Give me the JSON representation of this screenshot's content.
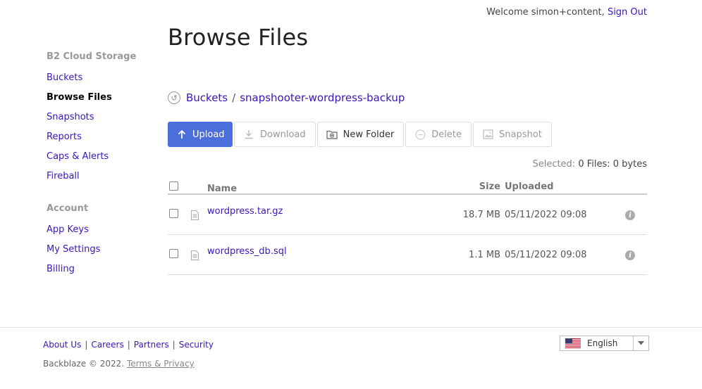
{
  "header": {
    "welcome_text": "Welcome simon+content,",
    "sign_out": "Sign Out"
  },
  "sidebar": {
    "section1": "B2 Cloud Storage",
    "items1": [
      {
        "label": "Buckets",
        "active": false
      },
      {
        "label": "Browse Files",
        "active": true
      },
      {
        "label": "Snapshots",
        "active": false
      },
      {
        "label": "Reports",
        "active": false
      },
      {
        "label": "Caps & Alerts",
        "active": false
      },
      {
        "label": "Fireball",
        "active": false
      }
    ],
    "section2": "Account",
    "items2": [
      {
        "label": "App Keys"
      },
      {
        "label": "My Settings"
      },
      {
        "label": "Billing"
      }
    ]
  },
  "page": {
    "title": "Browse Files"
  },
  "breadcrumb": {
    "root": "Buckets",
    "separator": "/",
    "current": "snapshooter-wordpress-backup"
  },
  "toolbar": {
    "upload": "Upload",
    "download": "Download",
    "new_folder": "New Folder",
    "delete": "Delete",
    "snapshot": "Snapshot"
  },
  "selection": {
    "label": "Selected:",
    "value": "0 Files: 0 bytes"
  },
  "table": {
    "columns": {
      "name": "Name",
      "size": "Size",
      "uploaded": "Uploaded"
    },
    "rows": [
      {
        "name": "wordpress.tar.gz",
        "size": "18.7 MB",
        "uploaded": "05/11/2022 09:08"
      },
      {
        "name": "wordpress_db.sql",
        "size": "1.1 MB",
        "uploaded": "05/11/2022 09:08"
      }
    ]
  },
  "footer": {
    "links": [
      "About Us",
      "Careers",
      "Partners",
      "Security"
    ],
    "copyright": "Backblaze © 2022.",
    "terms": "Terms & Privacy",
    "language": "English"
  },
  "colors": {
    "link": "#3a17b8",
    "primary_button": "#4a6fdc"
  }
}
